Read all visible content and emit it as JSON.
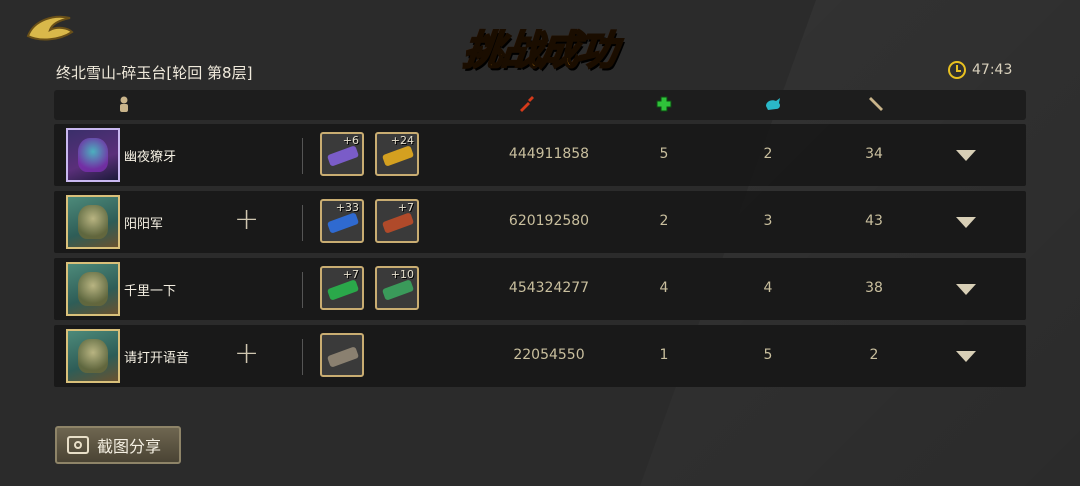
{
  "title": "挑战成功",
  "stage": "终北雪山-碎玉台[轮回 第8层]",
  "timer": "47:43",
  "colors": {
    "title": "#f7a51c",
    "dmg_icon": "#d63a1a",
    "heal_icon": "#2fc23a",
    "pet_icon": "#2ab8c8",
    "bone_icon": "#c9b48a"
  },
  "header_icons": [
    "player-icon",
    "damage-icon",
    "heal-icon",
    "pet-icon",
    "bone-icon"
  ],
  "players": [
    {
      "name": "幽夜獠牙",
      "weapons": [
        {
          "level": "+6",
          "color": "#7a5cc8"
        },
        {
          "level": "+24",
          "color": "#d4a020"
        }
      ],
      "score": "444911858",
      "c1": "5",
      "c2": "2",
      "c3": "34",
      "add": false
    },
    {
      "name": "阳阳军",
      "weapons": [
        {
          "level": "+33",
          "color": "#2f6ad0"
        },
        {
          "level": "+7",
          "color": "#b04a2a"
        }
      ],
      "score": "620192580",
      "c1": "2",
      "c2": "3",
      "c3": "43",
      "add": true
    },
    {
      "name": "千里一下",
      "weapons": [
        {
          "level": "+7",
          "color": "#2aa84a"
        },
        {
          "level": "+10",
          "color": "#3a9a5a"
        }
      ],
      "score": "454324277",
      "c1": "4",
      "c2": "4",
      "c3": "38",
      "add": false
    },
    {
      "name": "请打开语音",
      "weapons": [
        {
          "level": "",
          "color": "#8a8070"
        }
      ],
      "score": "22054550",
      "c1": "1",
      "c2": "5",
      "c3": "2",
      "add": true
    }
  ],
  "share_label": "截图分享"
}
